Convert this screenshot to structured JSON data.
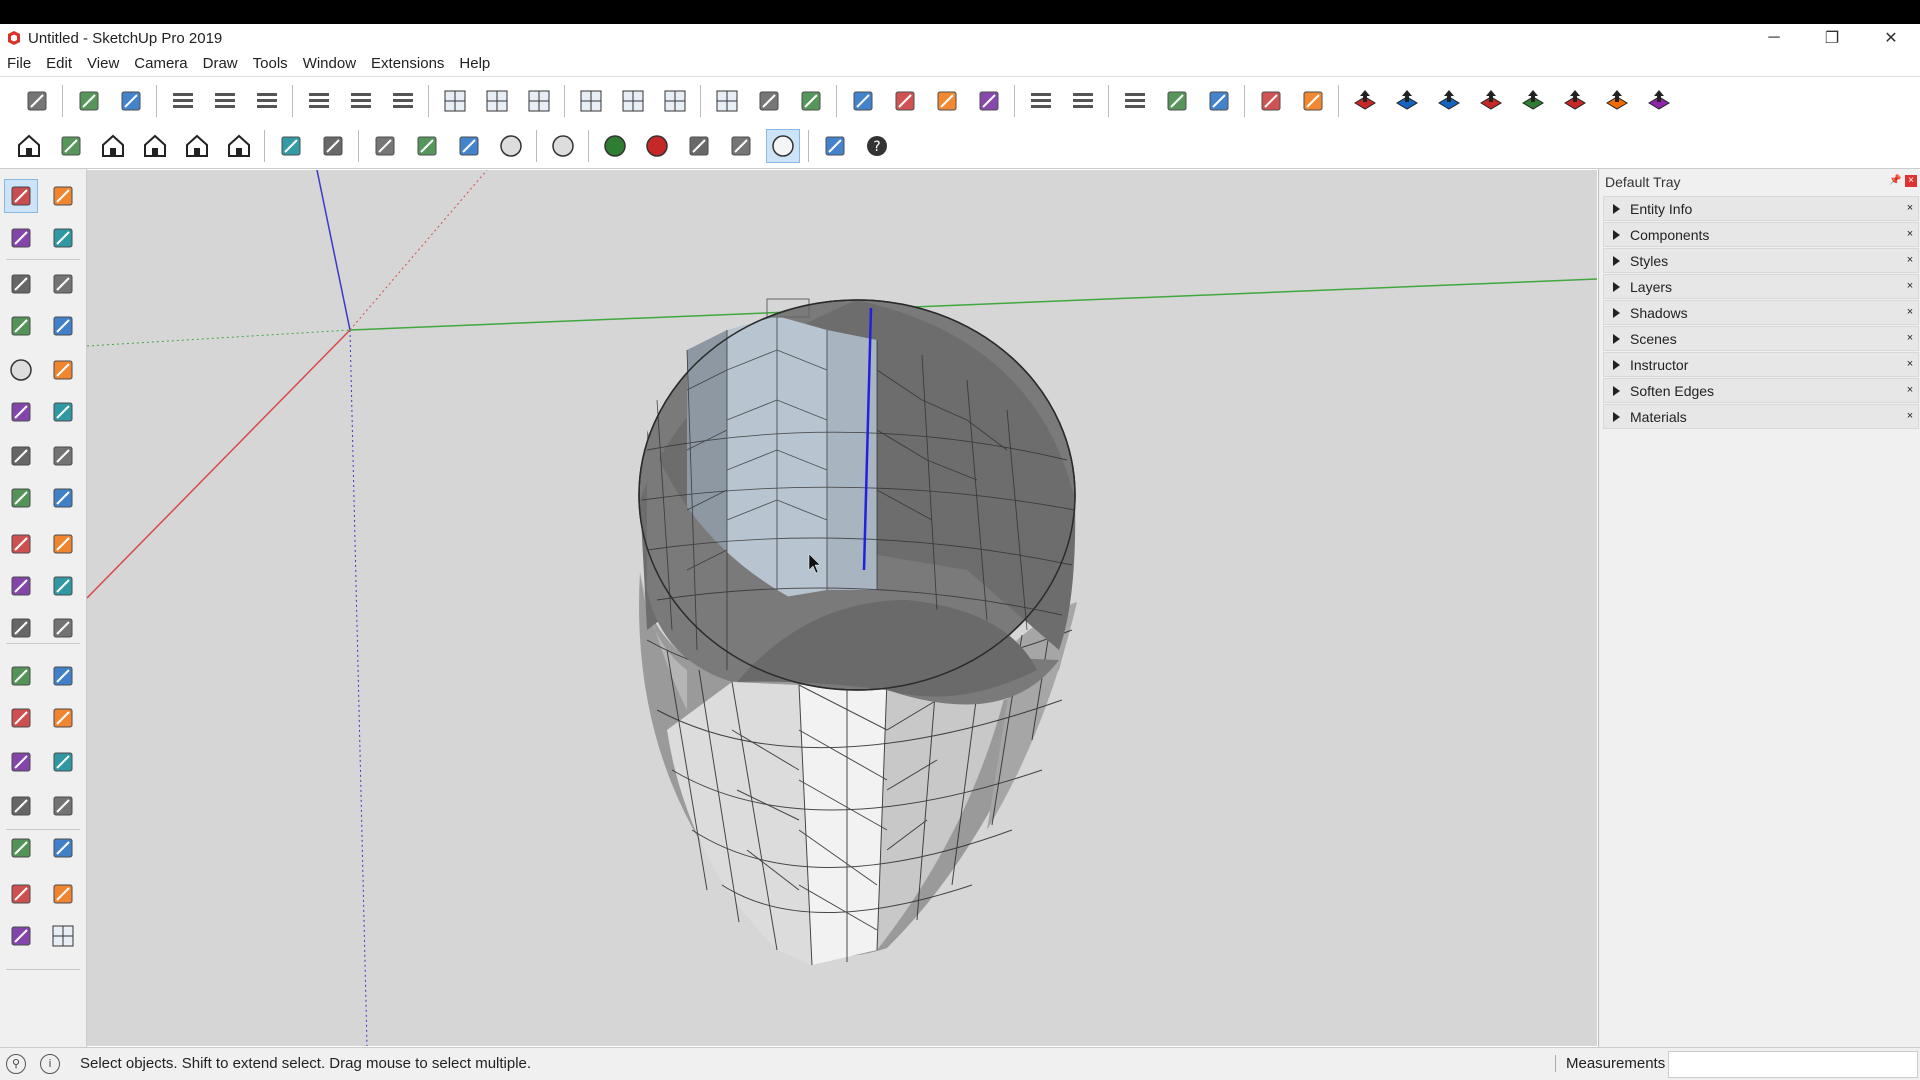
{
  "window": {
    "title": "Untitled - SketchUp Pro 2019",
    "minimize_glyph": "─",
    "restore_glyph": "❐",
    "close_glyph": "✕"
  },
  "menu": [
    "File",
    "Edit",
    "View",
    "Camera",
    "Draw",
    "Tools",
    "Window",
    "Extensions",
    "Help"
  ],
  "toolbar_top_icons": [
    "select-arrow",
    "component-make",
    "component-edit",
    "align-left",
    "align-center",
    "align-right",
    "distribute-h",
    "distribute-plus",
    "distribute-right",
    "section-box",
    "section-grid",
    "section-cross",
    "view-grid",
    "view-center",
    "view-x",
    "table-icon",
    "terrain-icon",
    "cloud-icon",
    "solid-tools",
    "copy-icon",
    "push-icon",
    "flip-icon",
    "split-h",
    "split-v",
    "move-down",
    "delete-x",
    "frame-icon",
    "pen-edit",
    "erase-red",
    "fredo-push",
    "fredo-blue",
    "fredo-j",
    "fredo-r",
    "fredo-v",
    "fredo-n",
    "fredo-x",
    "fredo-f"
  ],
  "toolbar_second_icons": [
    "warehouse-icon",
    "book-icon",
    "home-icon",
    "house-front",
    "house-outline",
    "house-open",
    "pencil-curve",
    "cursor-arrow",
    "move-arrows",
    "rotate-arrows",
    "scale-box",
    "help-circle",
    "sphere-wire",
    "sphere-green",
    "sphere-red",
    "shell-icon",
    "push-up",
    "sphere-white",
    "figure-icon",
    "question-blue"
  ],
  "tray": {
    "title": "Default Tray",
    "pin": "📌",
    "close": "×",
    "panels": [
      "Entity Info",
      "Components",
      "Styles",
      "Layers",
      "Shadows",
      "Scenes",
      "Instructor",
      "Soften Edges",
      "Materials"
    ]
  },
  "status": {
    "message": "Select objects. Shift to extend select. Drag mouse to select multiple.",
    "measurements_label": "Measurements",
    "measurements_value": "",
    "geo_icon": "⚲",
    "info_icon": "i"
  },
  "colors": {
    "axis_red": "#d84a4a",
    "axis_green": "#3fa83f",
    "axis_blue": "#3a3ac8",
    "viewport_bg": "#d6d6d6"
  }
}
